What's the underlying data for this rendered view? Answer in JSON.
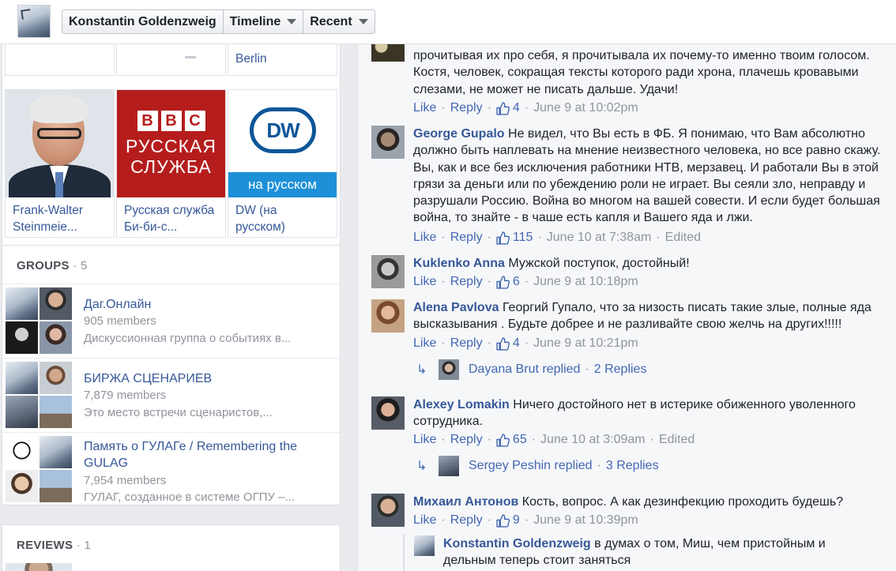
{
  "topbar": {
    "profile_name": "Konstantin Goldenzweig",
    "timeline_label": "Timeline",
    "recent_label": "Recent"
  },
  "likes": {
    "top_partial_label": "Berlin",
    "pages": [
      {
        "name": "Frank-Walter Steinmeie..."
      },
      {
        "name": "Русская служба Би-би-с...",
        "logo_line1": "РУССКАЯ",
        "logo_line2": "СЛУЖБА",
        "logo_letters": [
          "B",
          "B",
          "C"
        ]
      },
      {
        "name": "DW (на русском)",
        "logo": "DW",
        "banner": "на русском"
      }
    ]
  },
  "groups": {
    "title": "GROUPS",
    "count": "5",
    "items": [
      {
        "name": "Даг.Онлайн",
        "members": "905 members",
        "description": "Дискуссионная группа о событиях в..."
      },
      {
        "name": "БИРЖА СЦЕНАРИЕВ",
        "members": "7,879 members",
        "description": "Это место встречи сценаристов,..."
      },
      {
        "name": "Память о ГУЛАГе / Remembering the GULAG",
        "members": "7,954 members",
        "description": "ГУЛАГ, созданное в системе ОГПУ –..."
      }
    ]
  },
  "reviews": {
    "title": "REVIEWS",
    "count": "1"
  },
  "comments": [
    {
      "author": "",
      "text": "прочитывая их про себя, я прочитывала их почему-то именно твоим голосом. Костя, человек, сокращая тексты которого ради хрона, плачешь кровавыми слезами, не может не писать дальше. Удачи!",
      "like": "Like",
      "reply": "Reply",
      "likes": "4",
      "time": "June 9 at 10:02pm"
    },
    {
      "author": "George Gupalo",
      "text": "Не видел, что Вы есть в ФБ. Я понимаю, что Вам абсолютно должно быть наплевать на мнение неизвестного человека, но все равно скажу. Вы, как и все без исключения работники НТВ, мерзавец. И работали Вы в этой грязи за деньги или по убеждению роли не играет. Вы сеяли зло, неправду и разрушали Россию. Война во многом на вашей совести. И если будет большая война, то знайте - в чаше есть капля и Вашего яда и лжи.",
      "like": "Like",
      "reply": "Reply",
      "likes": "115",
      "time": "June 10 at 7:38am",
      "edited": "Edited"
    },
    {
      "author": "Kuklenko Anna",
      "text": "Мужской поступок, достойный!",
      "like": "Like",
      "reply": "Reply",
      "likes": "6",
      "time": "June 9 at 10:18pm"
    },
    {
      "author": "Alena Pavlova",
      "text": "Георгий Гупало, что за низость писать такие злые, полные яда высказывания . Будьте добрее и не разливайте свою желчь на других!!!!!",
      "like": "Like",
      "reply": "Reply",
      "likes": "4",
      "time": "June 9 at 10:21pm",
      "replied_by": "Dayana Brut replied",
      "replies": "2 Replies"
    },
    {
      "author": "Alexey Lomakin",
      "text": "Ничего достойного нет в истерике обиженного уволенного сотрудника.",
      "like": "Like",
      "reply": "Reply",
      "likes": "65",
      "time": "June 10 at 3:09am",
      "edited": "Edited",
      "replied_by": "Sergey Peshin replied",
      "replies": "3 Replies"
    },
    {
      "author": "Михаил Антонов",
      "text": "Кость, вопрос. А как дезинфекцию проходить будешь?",
      "like": "Like",
      "reply": "Reply",
      "likes": "9",
      "time": "June 9 at 10:39pm"
    }
  ],
  "nested_reply": {
    "author": "Konstantin Goldenzweig",
    "text": "в думах о том, Миш, чем пристойным и дельным теперь стоит заняться"
  },
  "colors": {
    "link": "#365899",
    "action": "#4267b2",
    "meta": "#90949c",
    "bbc_red": "#b51d1d",
    "dw_blue": "#0c5698"
  }
}
